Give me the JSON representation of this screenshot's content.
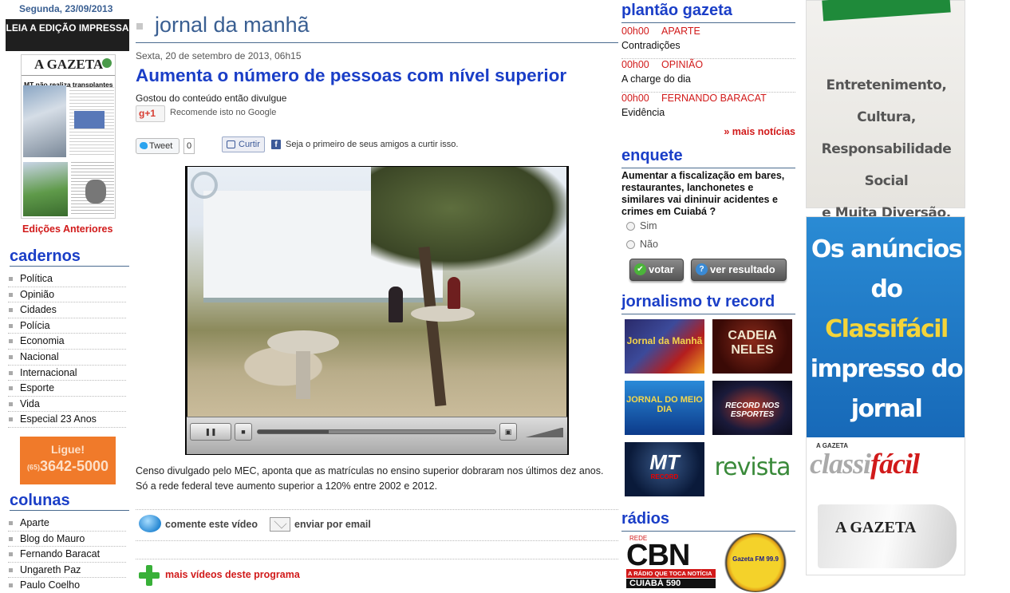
{
  "left": {
    "date": "Segunda, 23/09/2013",
    "edition_button": "LEIA A EDIÇÃO IMPRESSA",
    "paper_logo": "A GAZETA",
    "paper_headline": "MT não realiza transplantes",
    "previous_editions": "Edições Anteriores",
    "cadernos_title": "cadernos",
    "cadernos": [
      "Política",
      "Opinião",
      "Cidades",
      "Polícia",
      "Economia",
      "Nacional",
      "Internacional",
      "Esporte",
      "Vida",
      "Especial 23 Anos"
    ],
    "ligue": {
      "l1": "Ligue!",
      "ddd": "(65)",
      "phone": "3642-5000"
    },
    "colunas_title": "colunas",
    "colunas": [
      "Aparte",
      "Blog do Mauro",
      "Fernando Baracat",
      "Ungareth Paz",
      "Paulo Coelho"
    ]
  },
  "main": {
    "section_title": "jornal da manhã",
    "date": "Sexta, 20 de setembro de 2013, 06h15",
    "title": "Aumenta o número de pessoas com nível superior",
    "share_text": "Gostou do conteúdo então divulgue",
    "gplus_label": "+1",
    "gplus_text": "Recomende isto no Google",
    "tweet_label": "Tweet",
    "tweet_count": "0",
    "curtir_label": "Curtir",
    "fb_text": "Seja o primeiro de seus amigos a curtir isso.",
    "video_progress": 0.3,
    "description": "Censo divulgado pelo MEC, aponta que as matrículas no ensino superior dobraram nos últimos dez anos. Só a rede federal teve aumento superior a 120% entre 2002 e 2012.",
    "comment_label": "comente este vídeo",
    "email_label": "enviar por email",
    "more_videos_label": "mais vídeos deste programa"
  },
  "right": {
    "plantao_title": "plantão gazeta",
    "plantao": [
      {
        "time": "00h00",
        "category": "APARTE",
        "title": "Contradições"
      },
      {
        "time": "00h00",
        "category": "OPINIÃO",
        "title": "A charge do dia"
      },
      {
        "time": "00h00",
        "category": "FERNANDO BARACAT",
        "title": "Evidência"
      }
    ],
    "more_news": "» mais notícias",
    "enquete_title": "enquete",
    "poll_question": "Aumentar a fiscalização em bares, restaurantes, lanchonetes e similares vai dininuir acidentes e crimes em Cuiabá ?",
    "poll_options": [
      "Sim",
      "Não"
    ],
    "vote_label": "votar",
    "result_label": "ver resultado",
    "tv_title": "jornalismo tv record",
    "tv_programs": [
      "Jornal da Manhã",
      "CADEIA NELES",
      "JORNAL DO MEIO DIA",
      "RECORD NOS ESPORTES",
      "MT",
      "revista"
    ],
    "tv_mt_sub": "RECORD",
    "radios_title": "rádios",
    "cbn": {
      "rede": "REDE",
      "name": "CBN",
      "slogan": "A RÁDIO QUE TOCA NOTÍCIA",
      "city": "CUIABÁ 590"
    },
    "gazeta_fm": "Gazeta FM 99.9"
  },
  "ads": {
    "ad1_text": [
      "Entretenimento,",
      "Cultura,",
      "Responsabilidade Social",
      "e Muita Diversão."
    ],
    "ad2_text": [
      "Os anúncios",
      "do",
      "Classifácil",
      "impresso do",
      "jornal",
      "A Gazeta"
    ],
    "ad2_brand_a": "classi",
    "ad2_brand_b": "fácil",
    "ad2_brand_top": "A GAZETA",
    "ad2_roll": "A GAZETA"
  }
}
